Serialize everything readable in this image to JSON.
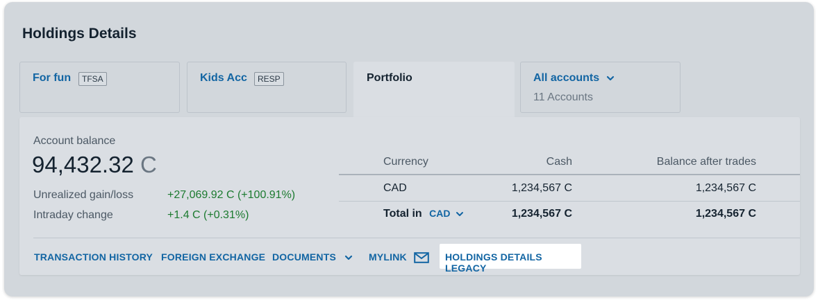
{
  "title": "Holdings Details",
  "tabs": [
    {
      "name": "For fun",
      "badge": "TFSA"
    },
    {
      "name": "Kids Acc",
      "badge": "RESP"
    },
    {
      "name": "Portfolio"
    },
    {
      "name": "All accounts",
      "sub": "11 Accounts"
    }
  ],
  "balance": {
    "label": "Account balance",
    "amount": "94,432.32",
    "currency": "C"
  },
  "stats": [
    {
      "label": "Unrealized gain/loss",
      "value": "+27,069.92 C (+100.91%)"
    },
    {
      "label": "Intraday change",
      "value": "+1.4 C (+0.31%)"
    }
  ],
  "table": {
    "headers": [
      "Currency",
      "Cash",
      "Balance after trades"
    ],
    "rows": [
      {
        "currency": "CAD",
        "cash": "1,234,567 C",
        "balance": "1,234,567 C"
      }
    ],
    "total": {
      "label": "Total in",
      "currency": "CAD",
      "cash": "1,234,567 C",
      "balance": "1,234,567 C"
    }
  },
  "links": {
    "transaction_history": "TRANSACTION HISTORY",
    "foreign_exchange": "FOREIGN EXCHANGE",
    "documents": "DOCUMENTS",
    "mylink": "MYLINK",
    "legacy": "HOLDINGS DETAILS LEGACY"
  },
  "colors": {
    "link": "#1265a3",
    "positive": "#1b7a2f"
  }
}
